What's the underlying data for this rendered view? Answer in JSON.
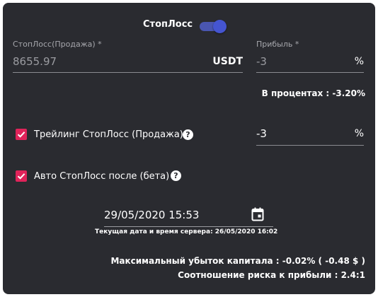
{
  "stoploss_toggle": {
    "label": "СтопЛосс",
    "enabled": true
  },
  "stoploss_field": {
    "label": "СтопЛосс(Продажа) *",
    "value": "8655.97",
    "suffix": "USDT"
  },
  "profit_field": {
    "label": "Прибыль *",
    "value": "-3",
    "suffix": "%"
  },
  "percent_note": "В процентах : -3.20%",
  "trailing": {
    "label": "Трейлинг СтопЛосс (Продажа)",
    "checked": true,
    "help_icon": "?",
    "value": "-3",
    "suffix": "%"
  },
  "auto": {
    "label": "Авто СтопЛосс после (бета)",
    "checked": true,
    "help_icon": "?"
  },
  "datetime": {
    "value": "29/05/2020 15:53",
    "icon": "calendar-icon",
    "server_note": "Текущая дата и время сервера: 26/05/2020 16:02"
  },
  "summary": {
    "max_loss": "Максимальный убыток капитала : -0.02% ( -0.48 $ )",
    "risk_ratio": "Соотношение риска к прибыли : 2.4:1"
  },
  "colors": {
    "panel_bg": "#2a2b30",
    "accent": "#4555d0",
    "checkbox": "#e0235a"
  }
}
